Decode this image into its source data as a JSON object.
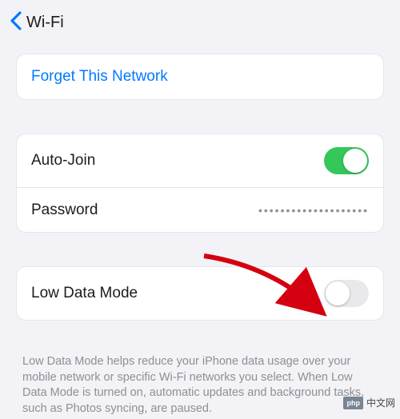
{
  "nav": {
    "title": "Wi-Fi"
  },
  "forget": {
    "label": "Forget This Network"
  },
  "settings": {
    "autojoin_label": "Auto-Join",
    "autojoin_on": true,
    "password_label": "Password",
    "password_mask": "••••••••••••••••••••"
  },
  "lowdata": {
    "label": "Low Data Mode",
    "on": false,
    "description": "Low Data Mode helps reduce your iPhone data usage over your mobile network or specific Wi-Fi networks you select. When Low Data Mode is turned on, automatic updates and background tasks, such as Photos syncing, are paused."
  },
  "watermark": {
    "badge": "php",
    "text": "中文网"
  }
}
